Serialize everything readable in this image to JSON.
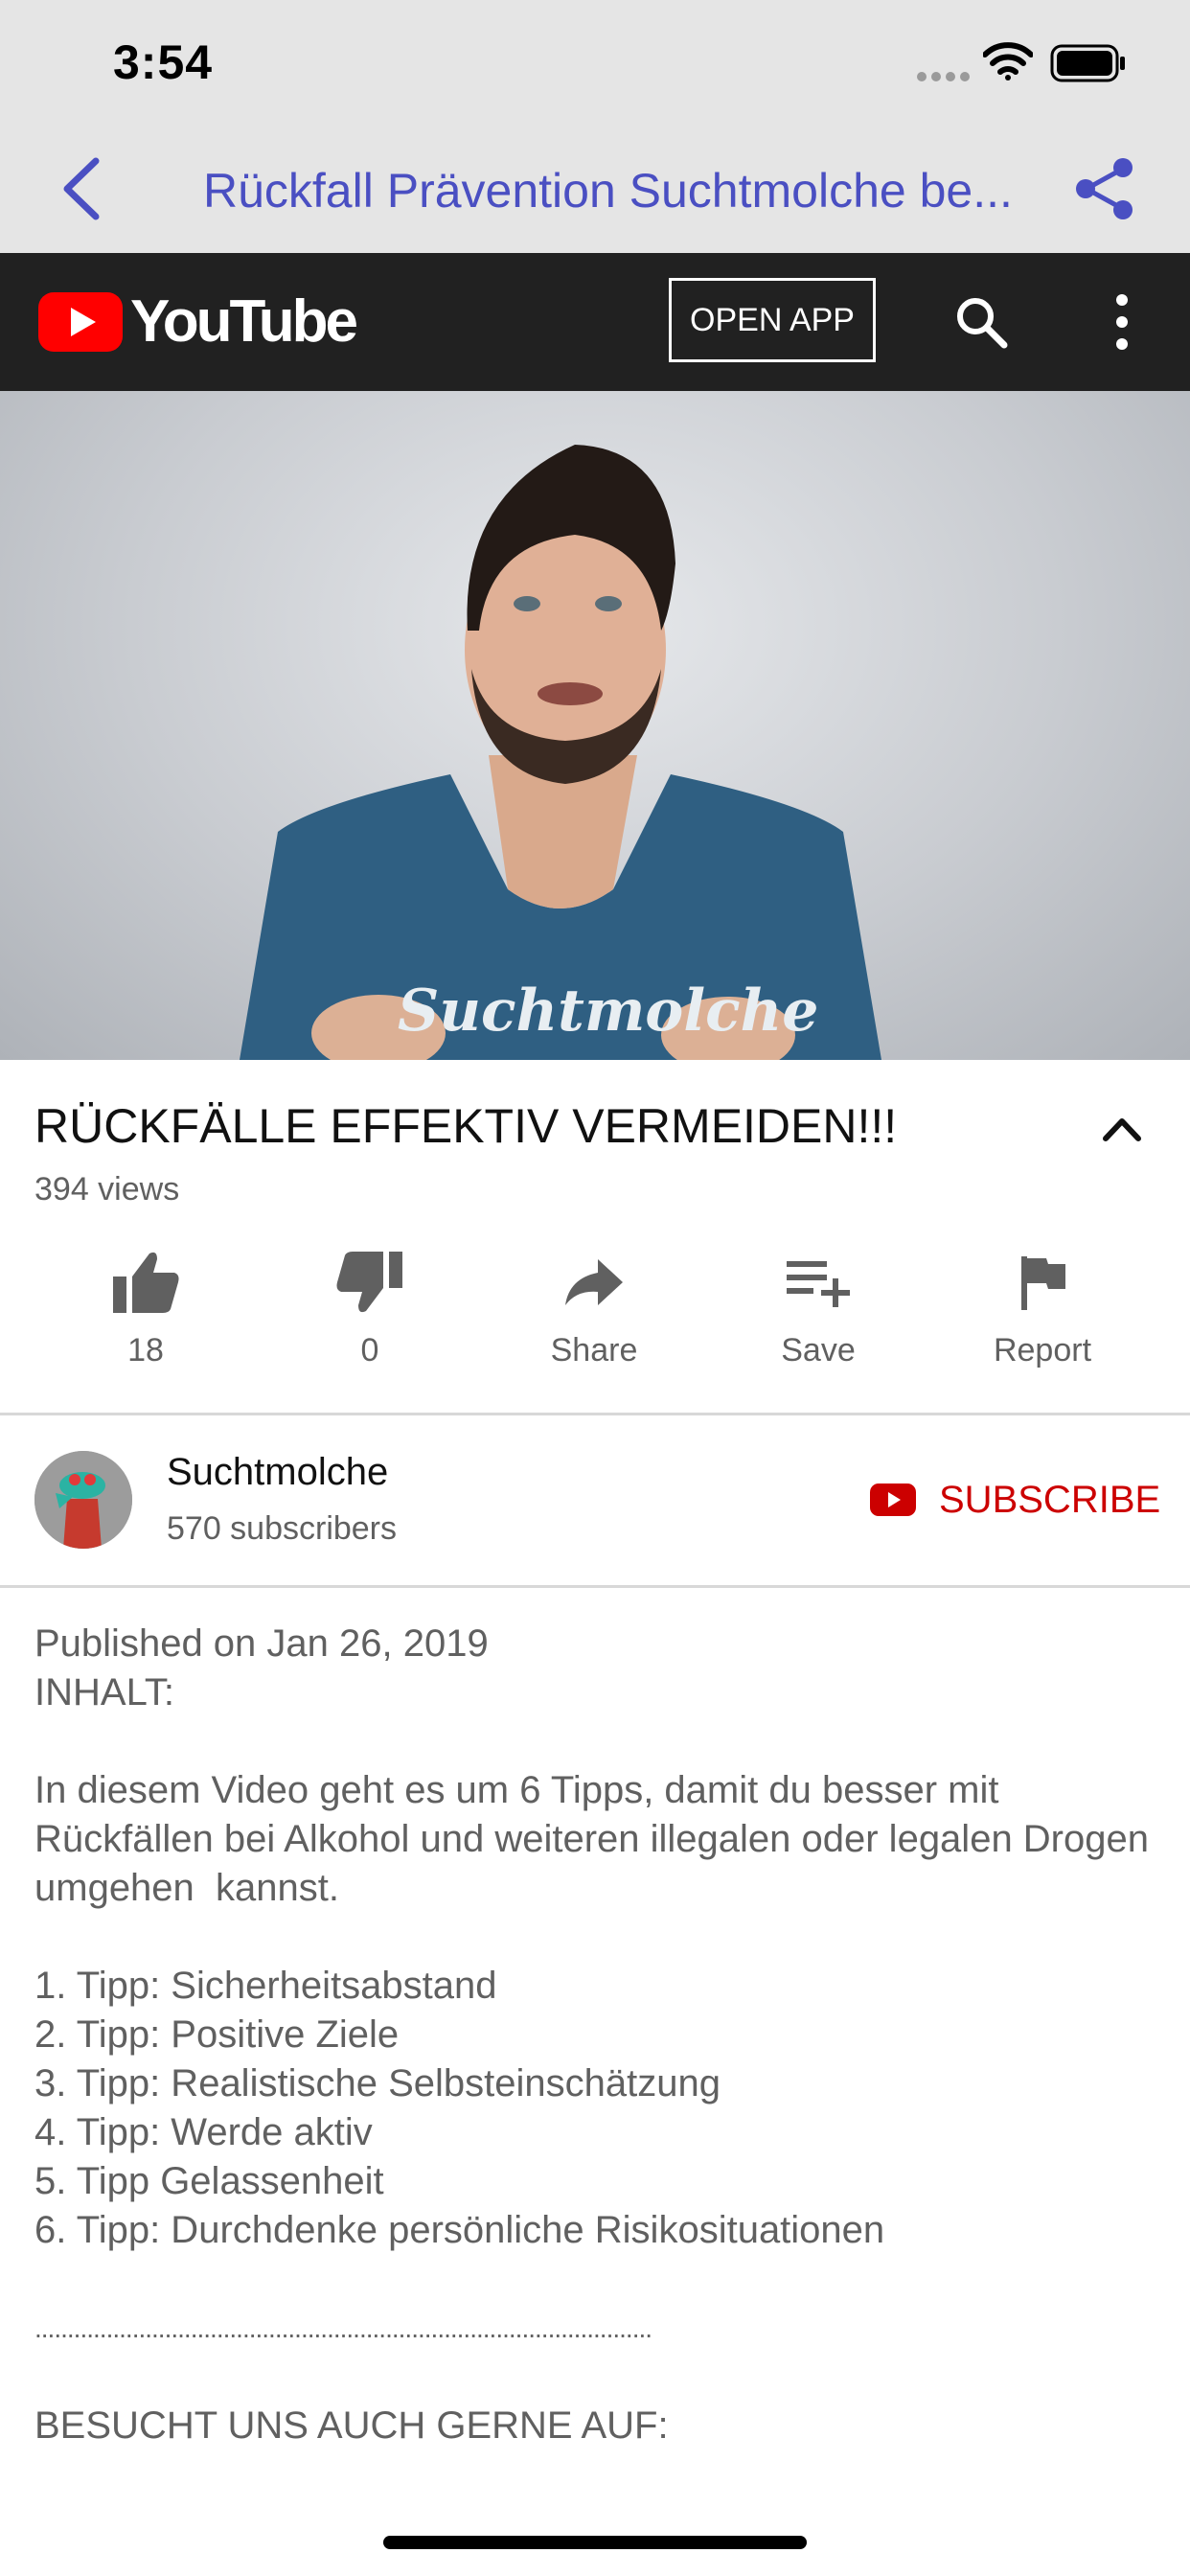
{
  "status_bar": {
    "time": "3:54"
  },
  "nav": {
    "title": "Rückfall Prävention Suchtmolche be..."
  },
  "youtube_header": {
    "logo_text": "YouTube",
    "open_app_label": "OPEN APP"
  },
  "video": {
    "title": "RÜCKFÄLLE EFFEKTIV VERMEIDEN!!!",
    "views": "394 views",
    "shirt_text": "Suchtmolche"
  },
  "actions": {
    "like_count": "18",
    "dislike_count": "0",
    "share_label": "Share",
    "save_label": "Save",
    "report_label": "Report"
  },
  "channel": {
    "name": "Suchtmolche",
    "subscribers": "570 subscribers",
    "subscribe_label": "SUBSCRIBE"
  },
  "description": {
    "published": "Published on Jan 26, 2019",
    "heading": "INHALT:",
    "intro": "In diesem Video geht es um 6 Tipps, damit du besser mit Rückfällen bei Alkohol und weiteren illegalen oder legalen Drogen umgehen  kannst.",
    "tips": [
      "1. Tipp: Sicherheitsabstand",
      "2. Tipp: Positive Ziele",
      "3. Tipp: Realistische Selbsteinschätzung",
      "4. Tipp: Werde aktiv",
      "5. Tipp Gelassenheit",
      "6. Tipp: Durchdenke persönliche Risikosituationen"
    ],
    "separator": "...............................................................................................",
    "footer": "BESUCHT UNS AUCH GERNE AUF:"
  },
  "colors": {
    "nav_accent": "#4a4fc2",
    "youtube_red": "#ff0000",
    "subscribe_red": "#cc0000",
    "header_dark": "#212121"
  },
  "icons": [
    "signal-icon",
    "wifi-icon",
    "battery-icon",
    "back-chevron-icon",
    "share-icon",
    "youtube-play-icon",
    "search-icon",
    "more-vertical-icon",
    "chevron-up-icon",
    "thumbs-up-icon",
    "thumbs-down-icon",
    "share-arrow-icon",
    "playlist-add-icon",
    "flag-icon"
  ]
}
